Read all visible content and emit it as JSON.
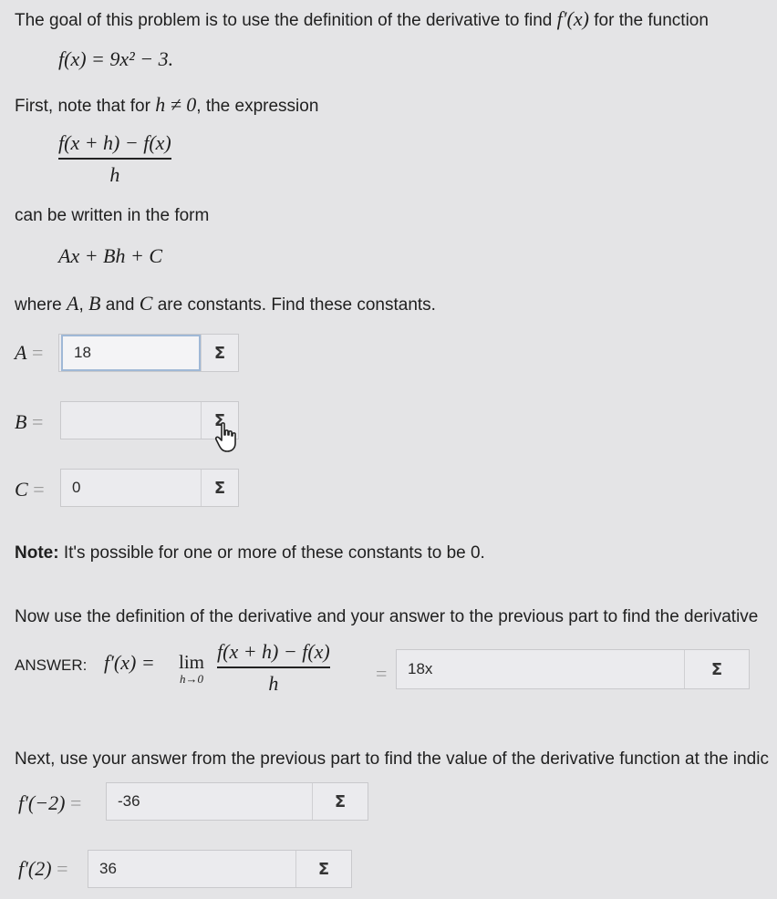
{
  "intro": {
    "line1_pre": "The goal of this problem is to use the definition of the derivative to find",
    "line1_math": "f′(x)",
    "line1_post": "for the function",
    "function": "f(x) = 9x² − 3.",
    "first_pre": "First, note that for",
    "first_math": "h ≠ 0",
    "first_post": ", the expression",
    "frac_num": "f(x + h) − f(x)",
    "frac_den": "h",
    "written": "can be written in the form",
    "form": "Ax + Bh + C",
    "where_a": "where",
    "where_b": "A",
    "where_c": ",",
    "where_d": "B",
    "where_e": "and",
    "where_f": "C",
    "where_g": "are constants. Find these constants."
  },
  "fields": {
    "a": {
      "label": "A",
      "eq": "=",
      "value": "18",
      "sigma": "Σ"
    },
    "b": {
      "label": "B",
      "eq": "=",
      "value": "",
      "sigma": "Σ"
    },
    "c": {
      "label": "C",
      "eq": "=",
      "value": "0",
      "sigma": "Σ"
    }
  },
  "note": {
    "bold": "Note:",
    "text": "It's possible for one or more of these constants to be 0."
  },
  "part2": {
    "instruction": "Now use the definition of the derivative and your answer to the previous part to find the derivative",
    "answer_label": "ANSWER:",
    "lhs": "f′(x) =",
    "lim": "lim",
    "lim_sub": "h→0",
    "frac_num": "f(x + h) − f(x)",
    "frac_den": "h",
    "eq": "=",
    "value": "18x",
    "sigma": "Σ"
  },
  "part3": {
    "instruction": "Next, use your answer from the previous part to find the value of the derivative function at the indic",
    "f_neg2": {
      "label": "f′(−2)",
      "eq": "=",
      "value": "-36",
      "sigma": "Σ"
    },
    "f_2": {
      "label": "f′(2)",
      "eq": "=",
      "value": "36",
      "sigma": "Σ"
    }
  },
  "icons": {
    "cursor": "hand-pointer-icon"
  }
}
